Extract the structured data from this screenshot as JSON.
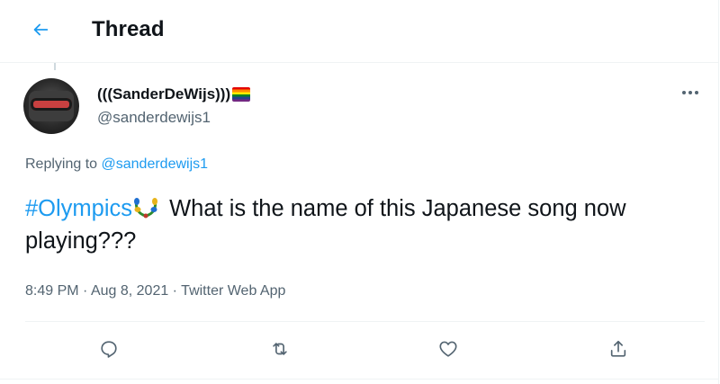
{
  "header": {
    "title": "Thread",
    "back_icon": "arrow-left-icon"
  },
  "tweet": {
    "display_name": "(((SanderDeWijs)))",
    "name_emoji": "rainbow-flag-icon",
    "handle": "@sanderdewijs1",
    "replying_prefix": "Replying to ",
    "replying_to": "@sanderdewijs1",
    "hashtag": "#Olympics",
    "hashtag_emoji": "olympic-wreath-icon",
    "text": " What is the name of this Japanese song now playing???",
    "time": "8:49 PM",
    "date": "Aug 8, 2021",
    "source": "Twitter Web App",
    "meta_sep": " · "
  },
  "actions": [
    {
      "name": "reply",
      "icon": "reply-icon"
    },
    {
      "name": "retweet",
      "icon": "retweet-icon"
    },
    {
      "name": "like",
      "icon": "heart-icon"
    },
    {
      "name": "share",
      "icon": "share-icon"
    }
  ],
  "colors": {
    "accent": "#1d9bf0",
    "text": "#0f1419",
    "secondary": "#536471",
    "divider": "#eff3f4"
  }
}
